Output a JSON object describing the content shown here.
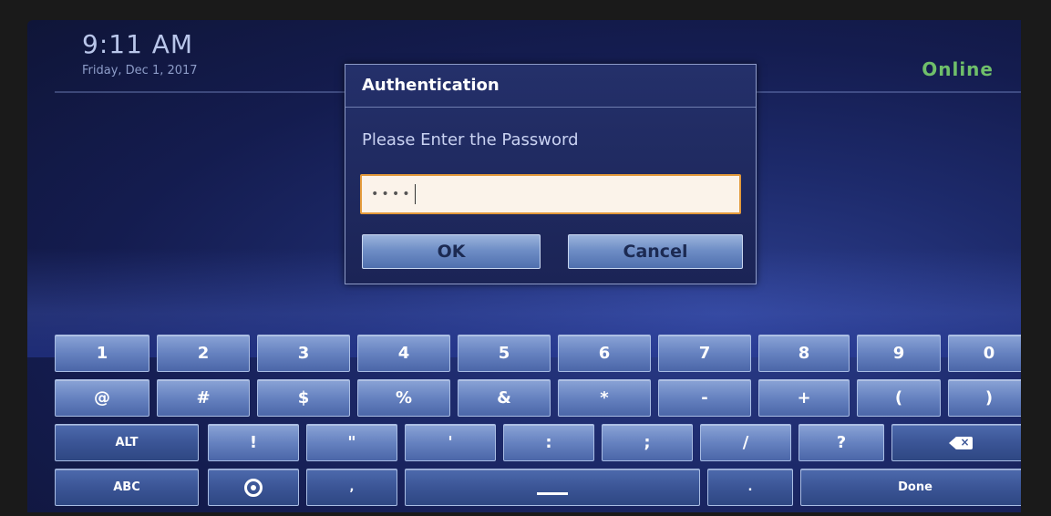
{
  "header": {
    "time": "9:11 AM",
    "date": "Friday, Dec 1, 2017",
    "status": "Online",
    "status_color": "#6fbf6a"
  },
  "dialog": {
    "title": "Authentication",
    "message": "Please Enter the Password",
    "password_value": "••••",
    "ok_label": "OK",
    "cancel_label": "Cancel"
  },
  "keyboard": {
    "row1": [
      "1",
      "2",
      "3",
      "4",
      "5",
      "6",
      "7",
      "8",
      "9",
      "0"
    ],
    "row2": [
      "@",
      "#",
      "$",
      "%",
      "&",
      "*",
      "-",
      "+",
      "(",
      ")"
    ],
    "row3": [
      "ALT",
      "!",
      "\"",
      "'",
      ":",
      ";",
      "/",
      "?"
    ],
    "row4": {
      "abc": "ABC",
      "comma": ",",
      "period": ".",
      "done": "Done"
    },
    "backspace_icon": "backspace-icon",
    "settings_icon": "settings-icon"
  }
}
